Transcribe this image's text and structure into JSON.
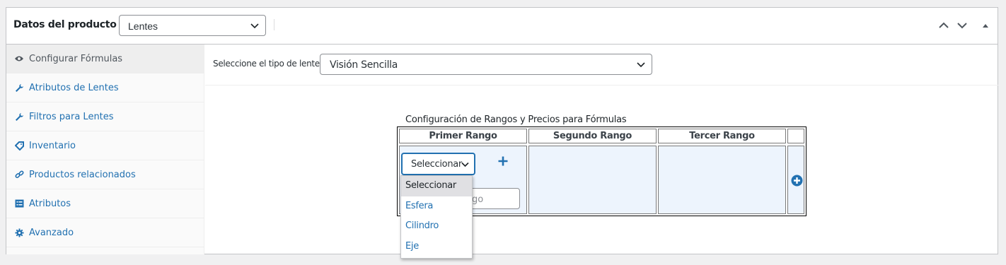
{
  "header": {
    "title": "Datos del producto —",
    "product_type_value": "Lentes"
  },
  "sidebar": {
    "items": [
      {
        "label": "Configurar Fórmulas",
        "icon": "eye-icon",
        "active": true
      },
      {
        "label": "Atributos de Lentes",
        "icon": "wrench-icon",
        "active": false
      },
      {
        "label": "Filtros para Lentes",
        "icon": "wrench-icon",
        "active": false
      },
      {
        "label": "Inventario",
        "icon": "tag-icon",
        "active": false
      },
      {
        "label": "Productos relacionados",
        "icon": "link-icon",
        "active": false
      },
      {
        "label": "Atributos",
        "icon": "list-icon",
        "active": false
      },
      {
        "label": "Avanzado",
        "icon": "gear-icon",
        "active": false
      }
    ]
  },
  "main": {
    "type_label": "Seleccione el tipo de lentes",
    "type_value": "Visión Sencilla",
    "config_title": "Configuración de Rangos y Precios para Fórmulas",
    "table": {
      "headers": [
        "Primer Rango",
        "Segundo Rango",
        "Tercer Rango",
        ""
      ],
      "range_select_value": "Seleccionar",
      "rango_input_partial": "go"
    },
    "dropdown": {
      "options": [
        "Seleccionar",
        "Esfera",
        "Cilindro",
        "Eje"
      ],
      "selected": "Seleccionar"
    }
  },
  "colors": {
    "accent": "#2271b1",
    "cell_bg": "#edf4fd",
    "panel_border": "#c3c4c7"
  }
}
